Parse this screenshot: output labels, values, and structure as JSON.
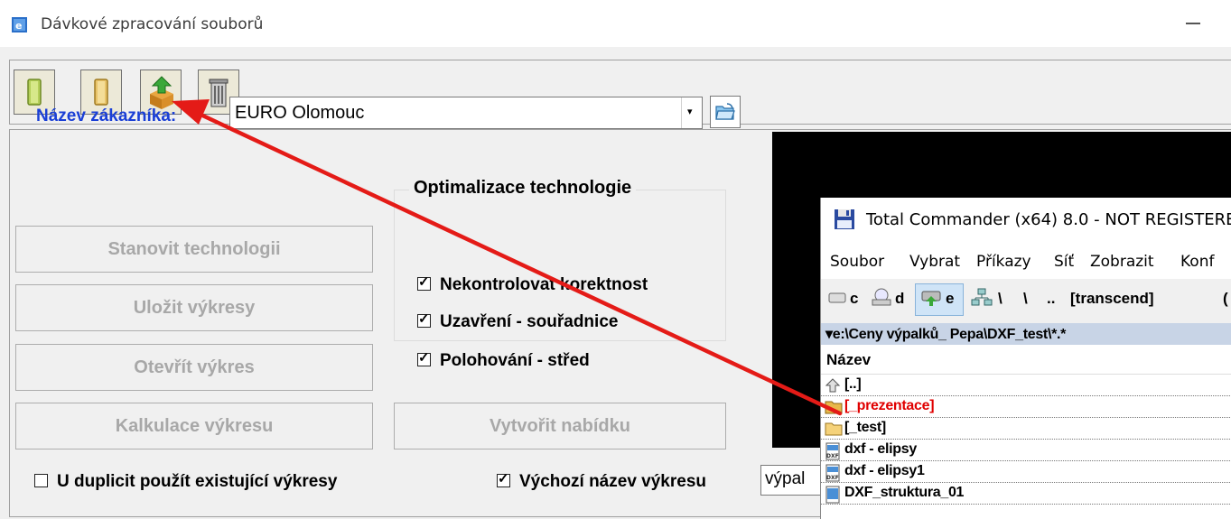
{
  "window": {
    "title": "Dávkové zpracování souborů",
    "accent": "#1a3fd6"
  },
  "toolbar": {
    "buttons": [
      {
        "icon": "green-folder-icon"
      },
      {
        "icon": "yellow-folder-icon"
      },
      {
        "icon": "import-box-icon"
      },
      {
        "icon": "trash-can-icon"
      }
    ]
  },
  "customer": {
    "label": "Název zákazníka:",
    "value": "EURO Olomouc",
    "dropdown_glyph": "▾"
  },
  "buttons": {
    "stanovit": "Stanovit technologii",
    "ulozit": "Uložit výkresy",
    "otevrit": "Otevřít výkres",
    "kalkulace": "Kalkulace výkresu",
    "vytvorit": "Vytvořit nabídku"
  },
  "optimization": {
    "title": "Optimalizace technologie",
    "options": [
      {
        "label": "Nekontrolovat korektnost",
        "checked": true
      },
      {
        "label": "Uzavření - souřadnice",
        "checked": true
      },
      {
        "label": "Polohování - střed",
        "checked": true
      }
    ]
  },
  "bottom": {
    "duplicates_label": "U duplicit použít existující výkresy",
    "duplicates_checked": false,
    "default_name_label": "Výchozí název výkresu",
    "default_name_checked": true,
    "name_value": "výpal"
  },
  "total_commander": {
    "title": "Total Commander (x64) 8.0 - NOT REGISTERE",
    "menu": [
      "Soubor",
      "Vybrat",
      "Příkazy",
      "Síť",
      "Zobrazit",
      "Konf"
    ],
    "drives": [
      "c",
      "d",
      "e",
      "\\",
      "\\",
      "..",
      "[transcend]",
      "("
    ],
    "path": "▾e:\\Ceny výpalků_ Pepa\\DXF_test\\*.*",
    "column_header": "Název",
    "files": [
      {
        "name": "[..]",
        "icon": "up-arrow-icon",
        "color": "#000000"
      },
      {
        "name": "[_prezentace]",
        "icon": "folder-icon",
        "color": "#e00000"
      },
      {
        "name": "[_test]",
        "icon": "folder-icon",
        "color": "#000000"
      },
      {
        "name": "dxf - elipsy",
        "icon": "dxf-file-icon",
        "color": "#000000"
      },
      {
        "name": "dxf - elipsy1",
        "icon": "dxf-file-icon",
        "color": "#000000"
      },
      {
        "name": "DXF_struktura_01",
        "icon": "dxf-file-icon",
        "color": "#000000"
      }
    ]
  }
}
